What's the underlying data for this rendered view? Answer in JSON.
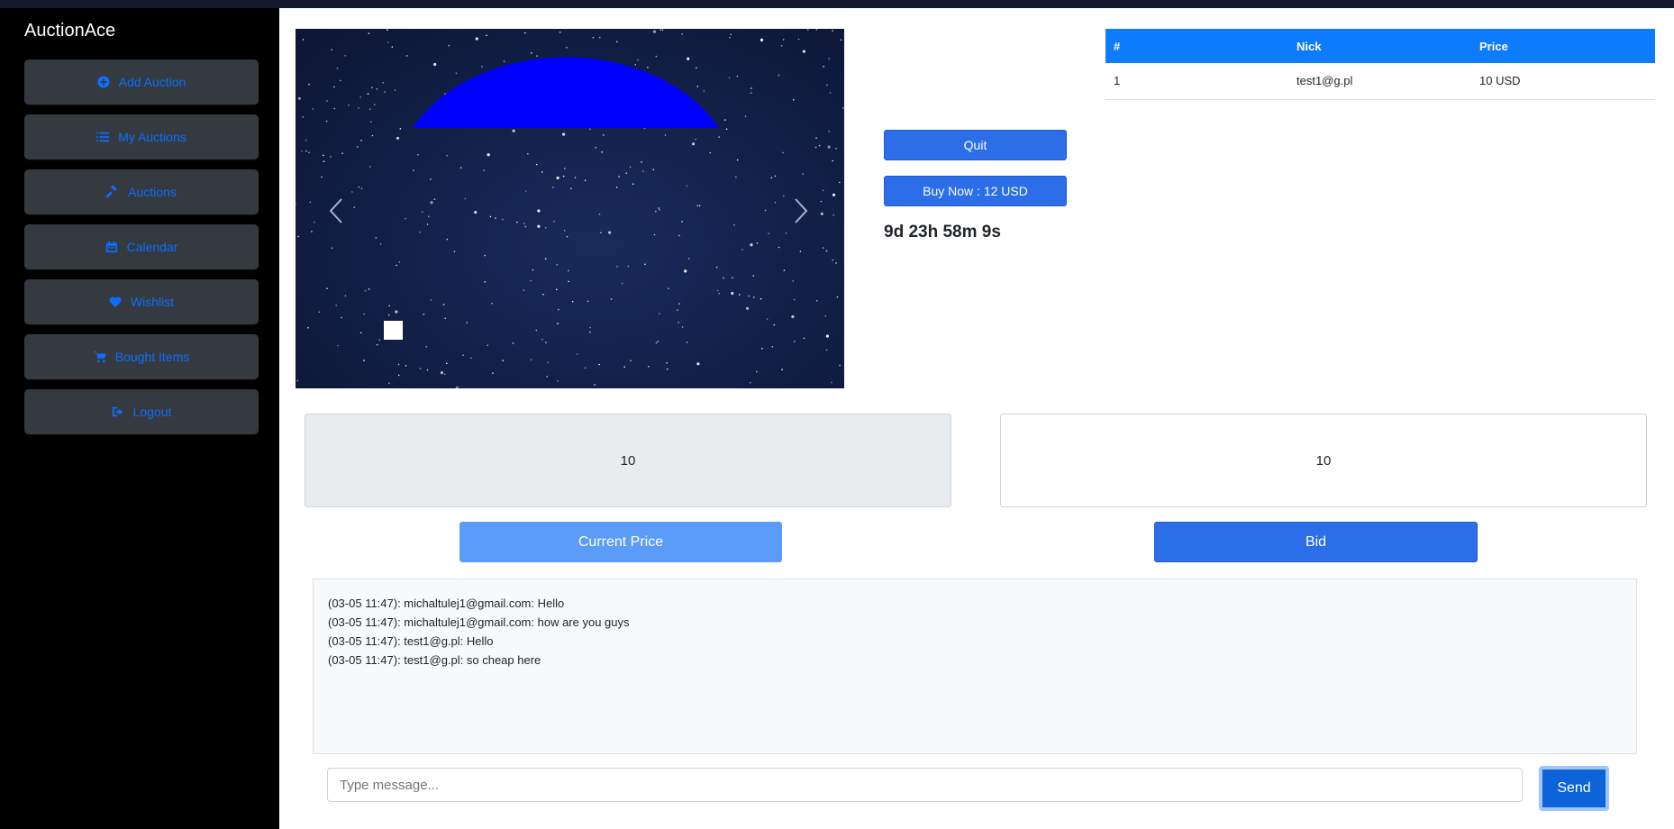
{
  "app": {
    "brand": "AuctionAce"
  },
  "sidebar": {
    "items": [
      {
        "label": "Add Auction",
        "icon": "plus-circle-icon"
      },
      {
        "label": "My Auctions",
        "icon": "list-icon"
      },
      {
        "label": "Auctions",
        "icon": "gavel-icon"
      },
      {
        "label": "Calendar",
        "icon": "calendar-icon"
      },
      {
        "label": "Wishlist",
        "icon": "heart-icon"
      },
      {
        "label": "Bought Items",
        "icon": "cart-icon"
      },
      {
        "label": "Logout",
        "icon": "logout-icon"
      }
    ]
  },
  "auction": {
    "quit_label": "Quit",
    "buy_now_label": "Buy Now : 12 USD",
    "countdown": "9d 23h 58m 9s"
  },
  "bids_table": {
    "headers": [
      "#",
      "Nick",
      "Price"
    ],
    "rows": [
      {
        "num": "1",
        "nick": "test1@g.pl",
        "price": "10 USD"
      }
    ]
  },
  "pricing": {
    "current_price_value": "10",
    "bid_value": "10",
    "current_price_label": "Current Price",
    "bid_label": "Bid"
  },
  "chat": {
    "messages": [
      "(03-05 11:47): michaltulej1@gmail.com: Hello",
      "(03-05 11:47): michaltulej1@gmail.com: how are you guys",
      "(03-05 11:47): test1@g.pl: Hello",
      "(03-05 11:47): test1@g.pl: so cheap here"
    ],
    "input_placeholder": "Type message...",
    "send_label": "Send"
  },
  "colors": {
    "accent": "#0d6efd",
    "sidebar_button": "#343a40",
    "table_header": "#0d7bfd",
    "current_price_button": "#5b9cf8",
    "bid_button": "#2b6ee8"
  }
}
